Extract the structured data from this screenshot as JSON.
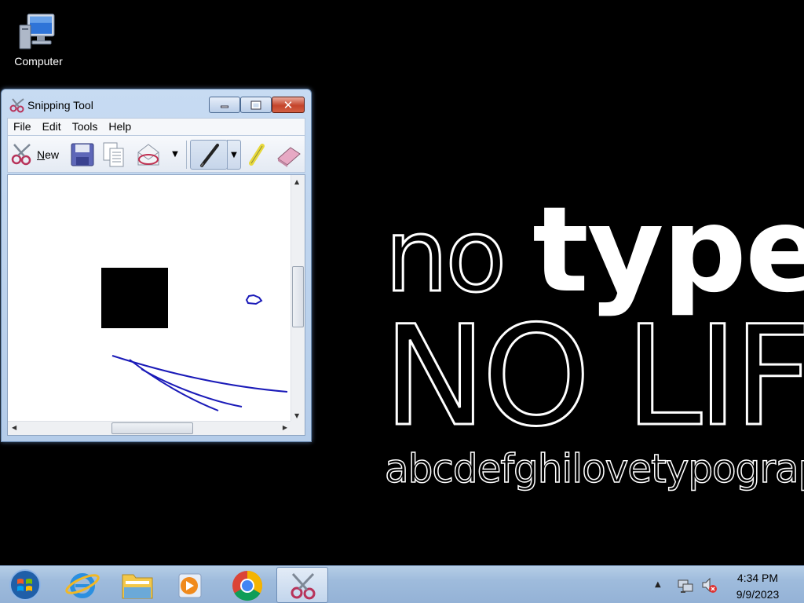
{
  "desktop": {
    "icons": [
      {
        "label": "Computer",
        "icon": "computer-icon"
      }
    ],
    "wallpaper": {
      "line1_thin": "no ",
      "line1_bold": "type",
      "line2": "NO LIFE",
      "line3": "abcdefghilovetypography."
    }
  },
  "window": {
    "title": "Snipping Tool",
    "menu": [
      "File",
      "Edit",
      "Tools",
      "Help"
    ],
    "toolbar": {
      "new_label": "New",
      "new_mnemonic": "N",
      "new_rest": "ew"
    },
    "canvas": {
      "background": "#ffffff",
      "ink_color": "#1a1ab8"
    }
  },
  "taskbar": {
    "apps": [
      {
        "name": "internet-explorer",
        "icon": "ie-icon",
        "active": false
      },
      {
        "name": "windows-explorer",
        "icon": "folder-icon",
        "active": false
      },
      {
        "name": "media-player",
        "icon": "media-player-icon",
        "active": false
      },
      {
        "name": "google-chrome",
        "icon": "chrome-icon",
        "active": false
      },
      {
        "name": "snipping-tool",
        "icon": "scissors-icon",
        "active": true
      }
    ],
    "clock": {
      "time": "4:34 PM",
      "date": "9/9/2023"
    }
  },
  "colors": {
    "desktop_bg": "#000000",
    "taskbar": "#9ebbdc",
    "close_button": "#c4442b",
    "ink": "#1a1ab8"
  }
}
